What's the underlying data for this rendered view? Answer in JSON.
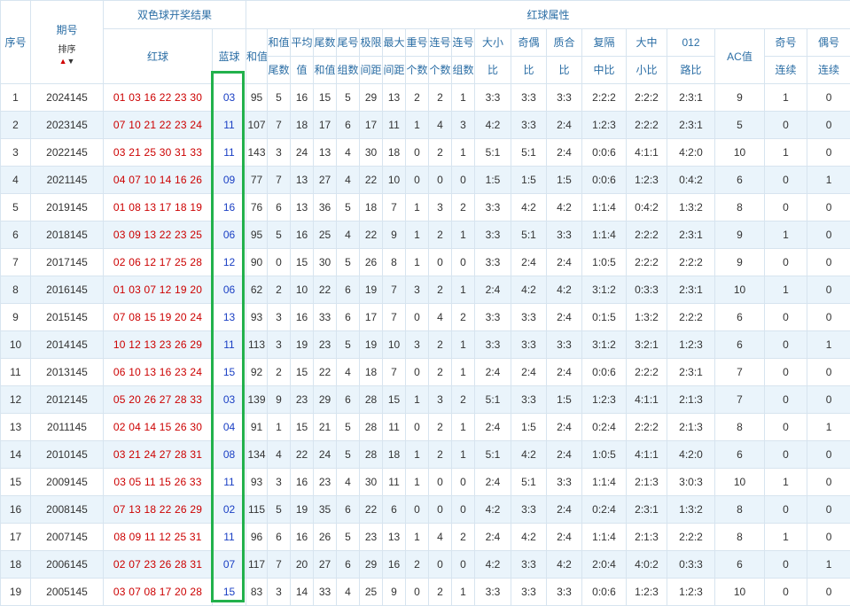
{
  "header": {
    "seq": "序号",
    "issue": "期号",
    "sort_label": "排序",
    "draw_group": "双色球开奖结果",
    "red_ball": "红球",
    "blue_ball": "蓝球",
    "attr_group": "红球属性",
    "sum": "和值",
    "sum_tail_top": "和值",
    "sum_tail_bottom": "尾数",
    "avg_top": "平均",
    "avg_bottom": "值",
    "tail_sum_top": "尾数",
    "tail_sum_bottom": "和值",
    "tail_grp_top": "尾号",
    "tail_grp_bottom": "组数",
    "span_top": "极限",
    "span_bottom": "间距",
    "maxgap_top": "最大",
    "maxgap_bottom": "间距",
    "repeat_top": "重号",
    "repeat_bottom": "个数",
    "consec_top": "连号",
    "consec_bottom": "个数",
    "consec_grp_top": "连号",
    "consec_grp_bottom": "组数",
    "bigsmall_top": "大小",
    "bigsmall_bottom": "比",
    "oddeven_top": "奇偶",
    "oddeven_bottom": "比",
    "prime_top": "质合",
    "prime_bottom": "比",
    "gap_top": "复隔",
    "gap_bottom": "中比",
    "bms_top": "大中",
    "bms_bottom": "小比",
    "road_top": "012",
    "road_bottom": "路比",
    "ac": "AC值",
    "odd_consec_top": "奇号",
    "odd_consec_bottom": "连续",
    "even_consec_top": "偶号",
    "even_consec_bottom": "连续"
  },
  "rows": [
    {
      "seq": "1",
      "issue": "2024145",
      "red": "01 03 16 22 23 30",
      "blue": "03",
      "c": [
        "95",
        "5",
        "16",
        "15",
        "5",
        "29",
        "13",
        "2",
        "2",
        "1",
        "3:3",
        "3:3",
        "3:3",
        "2:2:2",
        "2:2:2",
        "2:3:1",
        "9",
        "1",
        "0"
      ]
    },
    {
      "seq": "2",
      "issue": "2023145",
      "red": "07 10 21 22 23 24",
      "blue": "11",
      "c": [
        "107",
        "7",
        "18",
        "17",
        "6",
        "17",
        "11",
        "1",
        "4",
        "3",
        "4:2",
        "3:3",
        "2:4",
        "1:2:3",
        "2:2:2",
        "2:3:1",
        "5",
        "0",
        "0"
      ]
    },
    {
      "seq": "3",
      "issue": "2022145",
      "red": "03 21 25 30 31 33",
      "blue": "11",
      "c": [
        "143",
        "3",
        "24",
        "13",
        "4",
        "30",
        "18",
        "0",
        "2",
        "1",
        "5:1",
        "5:1",
        "2:4",
        "0:0:6",
        "4:1:1",
        "4:2:0",
        "10",
        "1",
        "0"
      ]
    },
    {
      "seq": "4",
      "issue": "2021145",
      "red": "04 07 10 14 16 26",
      "blue": "09",
      "c": [
        "77",
        "7",
        "13",
        "27",
        "4",
        "22",
        "10",
        "0",
        "0",
        "0",
        "1:5",
        "1:5",
        "1:5",
        "0:0:6",
        "1:2:3",
        "0:4:2",
        "6",
        "0",
        "1"
      ]
    },
    {
      "seq": "5",
      "issue": "2019145",
      "red": "01 08 13 17 18 19",
      "blue": "16",
      "c": [
        "76",
        "6",
        "13",
        "36",
        "5",
        "18",
        "7",
        "1",
        "3",
        "2",
        "3:3",
        "4:2",
        "4:2",
        "1:1:4",
        "0:4:2",
        "1:3:2",
        "8",
        "0",
        "0"
      ]
    },
    {
      "seq": "6",
      "issue": "2018145",
      "red": "03 09 13 22 23 25",
      "blue": "06",
      "c": [
        "95",
        "5",
        "16",
        "25",
        "4",
        "22",
        "9",
        "1",
        "2",
        "1",
        "3:3",
        "5:1",
        "3:3",
        "1:1:4",
        "2:2:2",
        "2:3:1",
        "9",
        "1",
        "0"
      ]
    },
    {
      "seq": "7",
      "issue": "2017145",
      "red": "02 06 12 17 25 28",
      "blue": "12",
      "c": [
        "90",
        "0",
        "15",
        "30",
        "5",
        "26",
        "8",
        "1",
        "0",
        "0",
        "3:3",
        "2:4",
        "2:4",
        "1:0:5",
        "2:2:2",
        "2:2:2",
        "9",
        "0",
        "0"
      ]
    },
    {
      "seq": "8",
      "issue": "2016145",
      "red": "01 03 07 12 19 20",
      "blue": "06",
      "c": [
        "62",
        "2",
        "10",
        "22",
        "6",
        "19",
        "7",
        "3",
        "2",
        "1",
        "2:4",
        "4:2",
        "4:2",
        "3:1:2",
        "0:3:3",
        "2:3:1",
        "10",
        "1",
        "0"
      ]
    },
    {
      "seq": "9",
      "issue": "2015145",
      "red": "07 08 15 19 20 24",
      "blue": "13",
      "c": [
        "93",
        "3",
        "16",
        "33",
        "6",
        "17",
        "7",
        "0",
        "4",
        "2",
        "3:3",
        "3:3",
        "2:4",
        "0:1:5",
        "1:3:2",
        "2:2:2",
        "6",
        "0",
        "0"
      ]
    },
    {
      "seq": "10",
      "issue": "2014145",
      "red": "10 12 13 23 26 29",
      "blue": "11",
      "c": [
        "113",
        "3",
        "19",
        "23",
        "5",
        "19",
        "10",
        "3",
        "2",
        "1",
        "3:3",
        "3:3",
        "3:3",
        "3:1:2",
        "3:2:1",
        "1:2:3",
        "6",
        "0",
        "1"
      ]
    },
    {
      "seq": "11",
      "issue": "2013145",
      "red": "06 10 13 16 23 24",
      "blue": "15",
      "c": [
        "92",
        "2",
        "15",
        "22",
        "4",
        "18",
        "7",
        "0",
        "2",
        "1",
        "2:4",
        "2:4",
        "2:4",
        "0:0:6",
        "2:2:2",
        "2:3:1",
        "7",
        "0",
        "0"
      ]
    },
    {
      "seq": "12",
      "issue": "2012145",
      "red": "05 20 26 27 28 33",
      "blue": "03",
      "c": [
        "139",
        "9",
        "23",
        "29",
        "6",
        "28",
        "15",
        "1",
        "3",
        "2",
        "5:1",
        "3:3",
        "1:5",
        "1:2:3",
        "4:1:1",
        "2:1:3",
        "7",
        "0",
        "0"
      ]
    },
    {
      "seq": "13",
      "issue": "2011145",
      "red": "02 04 14 15 26 30",
      "blue": "04",
      "c": [
        "91",
        "1",
        "15",
        "21",
        "5",
        "28",
        "11",
        "0",
        "2",
        "1",
        "2:4",
        "1:5",
        "2:4",
        "0:2:4",
        "2:2:2",
        "2:1:3",
        "8",
        "0",
        "1"
      ]
    },
    {
      "seq": "14",
      "issue": "2010145",
      "red": "03 21 24 27 28 31",
      "blue": "08",
      "c": [
        "134",
        "4",
        "22",
        "24",
        "5",
        "28",
        "18",
        "1",
        "2",
        "1",
        "5:1",
        "4:2",
        "2:4",
        "1:0:5",
        "4:1:1",
        "4:2:0",
        "6",
        "0",
        "0"
      ]
    },
    {
      "seq": "15",
      "issue": "2009145",
      "red": "03 05 11 15 26 33",
      "blue": "11",
      "c": [
        "93",
        "3",
        "16",
        "23",
        "4",
        "30",
        "11",
        "1",
        "0",
        "0",
        "2:4",
        "5:1",
        "3:3",
        "1:1:4",
        "2:1:3",
        "3:0:3",
        "10",
        "1",
        "0"
      ]
    },
    {
      "seq": "16",
      "issue": "2008145",
      "red": "07 13 18 22 26 29",
      "blue": "02",
      "c": [
        "115",
        "5",
        "19",
        "35",
        "6",
        "22",
        "6",
        "0",
        "0",
        "0",
        "4:2",
        "3:3",
        "2:4",
        "0:2:4",
        "2:3:1",
        "1:3:2",
        "8",
        "0",
        "0"
      ]
    },
    {
      "seq": "17",
      "issue": "2007145",
      "red": "08 09 11 12 25 31",
      "blue": "11",
      "c": [
        "96",
        "6",
        "16",
        "26",
        "5",
        "23",
        "13",
        "1",
        "4",
        "2",
        "2:4",
        "4:2",
        "2:4",
        "1:1:4",
        "2:1:3",
        "2:2:2",
        "8",
        "1",
        "0"
      ]
    },
    {
      "seq": "18",
      "issue": "2006145",
      "red": "02 07 23 26 28 31",
      "blue": "07",
      "c": [
        "117",
        "7",
        "20",
        "27",
        "6",
        "29",
        "16",
        "2",
        "0",
        "0",
        "4:2",
        "3:3",
        "4:2",
        "2:0:4",
        "4:0:2",
        "0:3:3",
        "6",
        "0",
        "1"
      ]
    },
    {
      "seq": "19",
      "issue": "2005145",
      "red": "03 07 08 17 20 28",
      "blue": "15",
      "c": [
        "83",
        "3",
        "14",
        "33",
        "4",
        "25",
        "9",
        "0",
        "2",
        "1",
        "3:3",
        "3:3",
        "3:3",
        "0:0:6",
        "1:2:3",
        "1:2:3",
        "10",
        "0",
        "0"
      ]
    }
  ],
  "colors": {
    "red_number": "#cc0000",
    "blue_number": "#1a3fc4",
    "header_text": "#2b6ea5",
    "stripe": "#eaf4fb",
    "highlight_border": "#22b14c"
  }
}
